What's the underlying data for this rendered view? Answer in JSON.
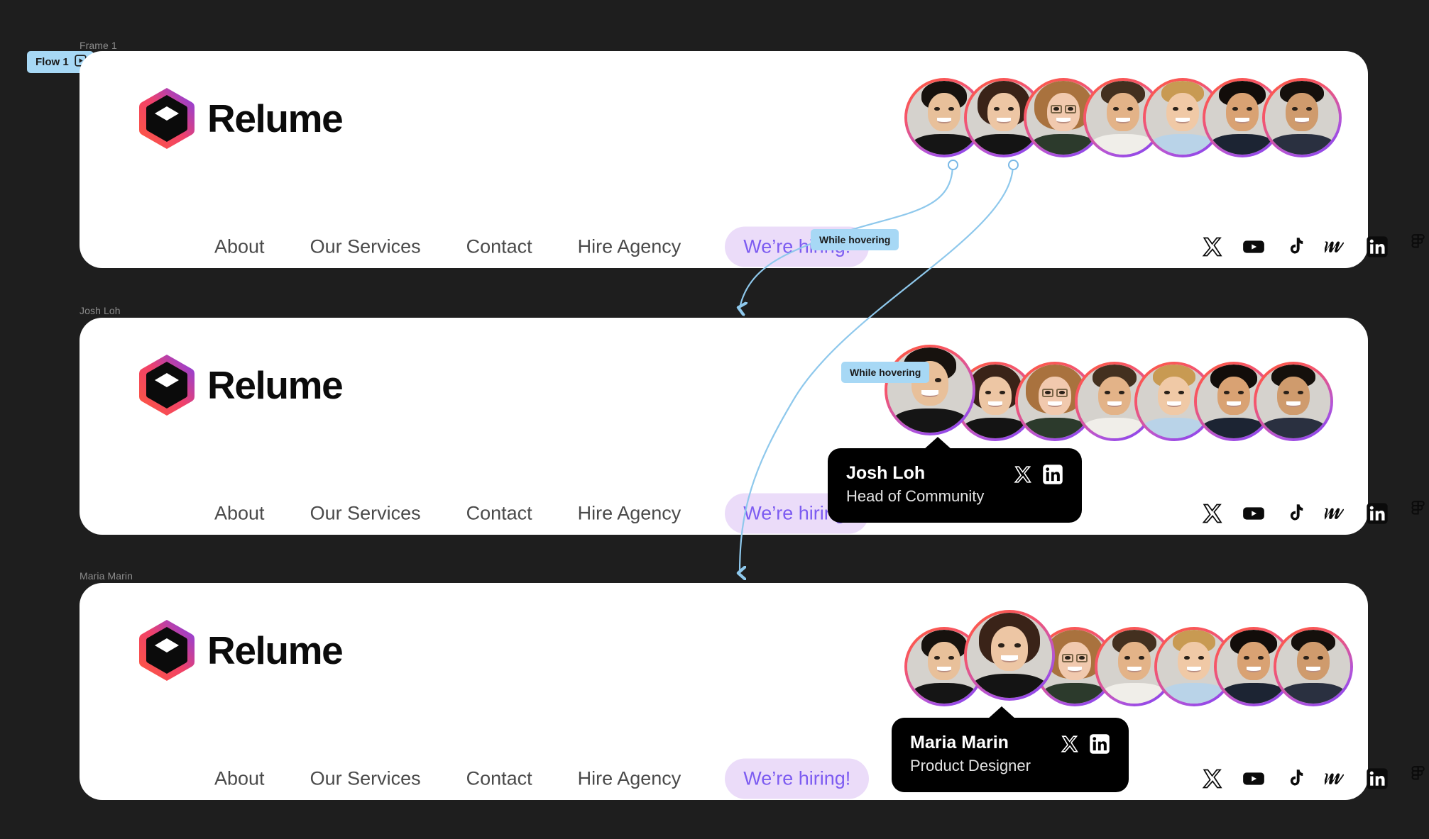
{
  "canvas": {
    "background": "#1e1e1e",
    "flow_badge": {
      "label": "Flow 1",
      "icon": "flow-play-icon",
      "color": "#a7d8f5"
    }
  },
  "frames": [
    {
      "label": "Frame 1"
    },
    {
      "label": "Josh Loh"
    },
    {
      "label": "Maria Marin"
    }
  ],
  "annotations": {
    "hover_1": "While hovering",
    "hover_2": "While hovering",
    "connector_color": "#8ec8ec"
  },
  "navbar": {
    "brand": {
      "name": "Relume",
      "logo_icon": "relume-hexagon-cube-logo",
      "gradient_from": "#ff5a3c",
      "gradient_to": "#7b3ff2"
    },
    "links": [
      {
        "label": "About"
      },
      {
        "label": "Our Services"
      },
      {
        "label": "Contact"
      },
      {
        "label": "Hire Agency"
      }
    ],
    "cta": {
      "label": "We’re hiring!",
      "bg": "#ebdcf9",
      "color": "#7d5cf1"
    },
    "socials": [
      {
        "name": "x-twitter-icon",
        "label": "X"
      },
      {
        "name": "youtube-icon",
        "label": "YouTube"
      },
      {
        "name": "tiktok-icon",
        "label": "TikTok"
      },
      {
        "name": "webflow-icon",
        "label": "Webflow"
      },
      {
        "name": "linkedin-icon",
        "label": "LinkedIn"
      },
      {
        "name": "figma-icon",
        "label": "Figma"
      }
    ],
    "team": [
      {
        "name": "Josh Loh",
        "role": "Head of Community"
      },
      {
        "name": "Maria Marin",
        "role": "Product Designer"
      },
      {
        "name": "Team member 3",
        "role": ""
      },
      {
        "name": "Team member 4",
        "role": ""
      },
      {
        "name": "Team member 5",
        "role": ""
      },
      {
        "name": "Team member 6",
        "role": ""
      },
      {
        "name": "Team member 7",
        "role": ""
      }
    ]
  },
  "tooltips": [
    {
      "name": "Josh Loh",
      "role": "Head of Community",
      "socials": [
        "x-twitter-icon",
        "linkedin-icon"
      ]
    },
    {
      "name": "Maria Marin",
      "role": "Product Designer",
      "socials": [
        "x-twitter-icon",
        "linkedin-icon"
      ]
    }
  ]
}
